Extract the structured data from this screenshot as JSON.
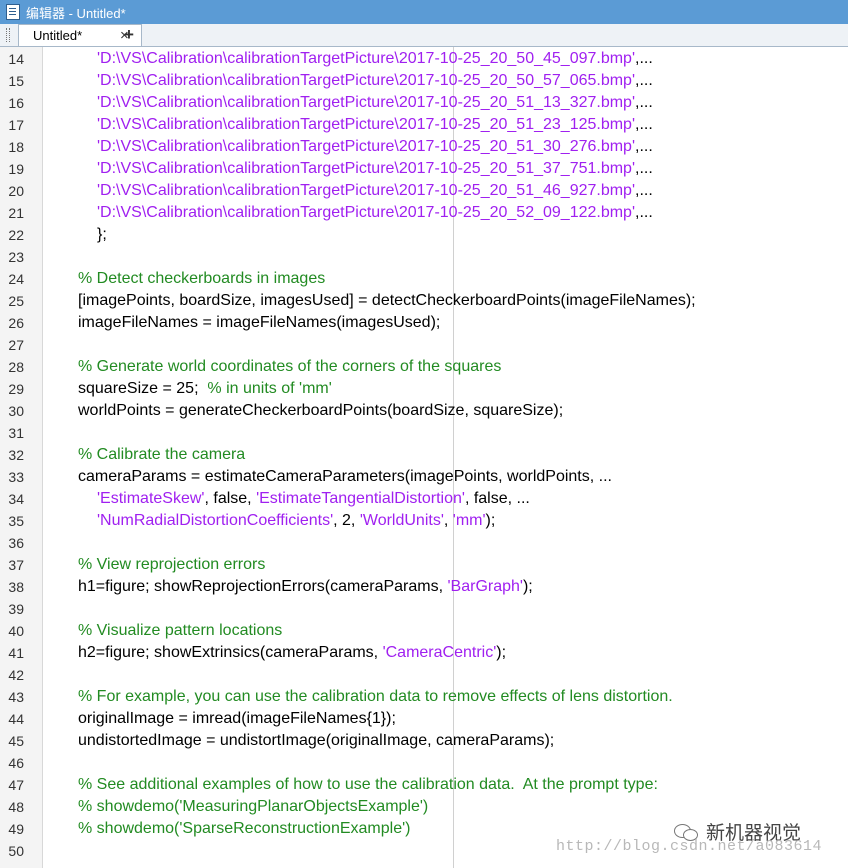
{
  "window": {
    "title": "编辑器 - Untitled*"
  },
  "tabs": [
    {
      "label": "Untitled*",
      "close": "×"
    }
  ],
  "add_tab": "+",
  "code_lines": [
    {
      "n": "14",
      "indent": true,
      "segments": [
        {
          "t": "'D:\\VS\\Calibration\\calibrationTargetPicture\\2017-10-25_20_50_45_097.bmp'",
          "c": "str"
        },
        {
          "t": ",...",
          "c": ""
        }
      ]
    },
    {
      "n": "15",
      "indent": true,
      "segments": [
        {
          "t": "'D:\\VS\\Calibration\\calibrationTargetPicture\\2017-10-25_20_50_57_065.bmp'",
          "c": "str"
        },
        {
          "t": ",...",
          "c": ""
        }
      ]
    },
    {
      "n": "16",
      "indent": true,
      "segments": [
        {
          "t": "'D:\\VS\\Calibration\\calibrationTargetPicture\\2017-10-25_20_51_13_327.bmp'",
          "c": "str"
        },
        {
          "t": ",...",
          "c": ""
        }
      ]
    },
    {
      "n": "17",
      "indent": true,
      "segments": [
        {
          "t": "'D:\\VS\\Calibration\\calibrationTargetPicture\\2017-10-25_20_51_23_125.bmp'",
          "c": "str"
        },
        {
          "t": ",...",
          "c": ""
        }
      ]
    },
    {
      "n": "18",
      "indent": true,
      "segments": [
        {
          "t": "'D:\\VS\\Calibration\\calibrationTargetPicture\\2017-10-25_20_51_30_276.bmp'",
          "c": "str"
        },
        {
          "t": ",...",
          "c": ""
        }
      ]
    },
    {
      "n": "19",
      "indent": true,
      "segments": [
        {
          "t": "'D:\\VS\\Calibration\\calibrationTargetPicture\\2017-10-25_20_51_37_751.bmp'",
          "c": "str"
        },
        {
          "t": ",...",
          "c": ""
        }
      ]
    },
    {
      "n": "20",
      "indent": true,
      "segments": [
        {
          "t": "'D:\\VS\\Calibration\\calibrationTargetPicture\\2017-10-25_20_51_46_927.bmp'",
          "c": "str"
        },
        {
          "t": ",...",
          "c": ""
        }
      ]
    },
    {
      "n": "21",
      "indent": true,
      "segments": [
        {
          "t": "'D:\\VS\\Calibration\\calibrationTargetPicture\\2017-10-25_20_52_09_122.bmp'",
          "c": "str"
        },
        {
          "t": ",...",
          "c": ""
        }
      ]
    },
    {
      "n": "22",
      "indent": true,
      "segments": [
        {
          "t": "};",
          "c": ""
        }
      ]
    },
    {
      "n": "23",
      "indent": false,
      "segments": []
    },
    {
      "n": "24",
      "indent": false,
      "segments": [
        {
          "t": "% Detect checkerboards in images",
          "c": "cmt"
        }
      ]
    },
    {
      "n": "25",
      "indent": false,
      "segments": [
        {
          "t": "[imagePoints, boardSize, imagesUsed] = detectCheckerboardPoints(imageFileNames);",
          "c": ""
        }
      ]
    },
    {
      "n": "26",
      "indent": false,
      "segments": [
        {
          "t": "imageFileNames = imageFileNames(imagesUsed);",
          "c": ""
        }
      ]
    },
    {
      "n": "27",
      "indent": false,
      "segments": []
    },
    {
      "n": "28",
      "indent": false,
      "segments": [
        {
          "t": "% Generate world coordinates of the corners of the squares",
          "c": "cmt"
        }
      ]
    },
    {
      "n": "29",
      "indent": false,
      "segments": [
        {
          "t": "squareSize = 25;  ",
          "c": ""
        },
        {
          "t": "% in units of 'mm'",
          "c": "cmt"
        }
      ]
    },
    {
      "n": "30",
      "indent": false,
      "segments": [
        {
          "t": "worldPoints = generateCheckerboardPoints(boardSize, squareSize);",
          "c": ""
        }
      ]
    },
    {
      "n": "31",
      "indent": false,
      "segments": []
    },
    {
      "n": "32",
      "indent": false,
      "segments": [
        {
          "t": "% Calibrate the camera",
          "c": "cmt"
        }
      ]
    },
    {
      "n": "33",
      "indent": false,
      "segments": [
        {
          "t": "cameraParams = estimateCameraParameters(imagePoints, worldPoints, ...",
          "c": ""
        }
      ]
    },
    {
      "n": "34",
      "indent": true,
      "segments": [
        {
          "t": "'EstimateSkew'",
          "c": "str"
        },
        {
          "t": ", false, ",
          "c": ""
        },
        {
          "t": "'EstimateTangentialDistortion'",
          "c": "str"
        },
        {
          "t": ", false, ...",
          "c": ""
        }
      ]
    },
    {
      "n": "35",
      "indent": true,
      "segments": [
        {
          "t": "'NumRadialDistortionCoefficients'",
          "c": "str"
        },
        {
          "t": ", 2, ",
          "c": ""
        },
        {
          "t": "'WorldUnits'",
          "c": "str"
        },
        {
          "t": ", ",
          "c": ""
        },
        {
          "t": "'mm'",
          "c": "str"
        },
        {
          "t": ");",
          "c": ""
        }
      ]
    },
    {
      "n": "36",
      "indent": false,
      "segments": []
    },
    {
      "n": "37",
      "indent": false,
      "segments": [
        {
          "t": "% View reprojection errors",
          "c": "cmt"
        }
      ]
    },
    {
      "n": "38",
      "indent": false,
      "segments": [
        {
          "t": "h1=figure; showReprojectionErrors(cameraParams, ",
          "c": ""
        },
        {
          "t": "'BarGraph'",
          "c": "str"
        },
        {
          "t": ");",
          "c": ""
        }
      ]
    },
    {
      "n": "39",
      "indent": false,
      "segments": []
    },
    {
      "n": "40",
      "indent": false,
      "segments": [
        {
          "t": "% Visualize pattern locations",
          "c": "cmt"
        }
      ]
    },
    {
      "n": "41",
      "indent": false,
      "segments": [
        {
          "t": "h2=figure; showExtrinsics(cameraParams, ",
          "c": ""
        },
        {
          "t": "'CameraCentric'",
          "c": "str"
        },
        {
          "t": ");",
          "c": ""
        }
      ]
    },
    {
      "n": "42",
      "indent": false,
      "segments": []
    },
    {
      "n": "43",
      "indent": false,
      "segments": [
        {
          "t": "% For example, you can use the calibration data to remove effects of lens distortion.",
          "c": "cmt"
        }
      ]
    },
    {
      "n": "44",
      "indent": false,
      "segments": [
        {
          "t": "originalImage = imread(imageFileNames{1});",
          "c": ""
        }
      ]
    },
    {
      "n": "45",
      "indent": false,
      "segments": [
        {
          "t": "undistortedImage = undistortImage(originalImage, cameraParams);",
          "c": ""
        }
      ]
    },
    {
      "n": "46",
      "indent": false,
      "segments": []
    },
    {
      "n": "47",
      "indent": false,
      "segments": [
        {
          "t": "% See additional examples of how to use the calibration data.  At the prompt type:",
          "c": "cmt"
        }
      ]
    },
    {
      "n": "48",
      "indent": false,
      "segments": [
        {
          "t": "% showdemo('MeasuringPlanarObjectsExample')",
          "c": "cmt"
        }
      ]
    },
    {
      "n": "49",
      "indent": false,
      "segments": [
        {
          "t": "% showdemo('SparseReconstructionExample')",
          "c": "cmt"
        }
      ]
    },
    {
      "n": "50",
      "indent": false,
      "segments": []
    }
  ],
  "watermark": {
    "brand": "新机器视觉",
    "url": "http://blog.csdn.net/a083614"
  }
}
